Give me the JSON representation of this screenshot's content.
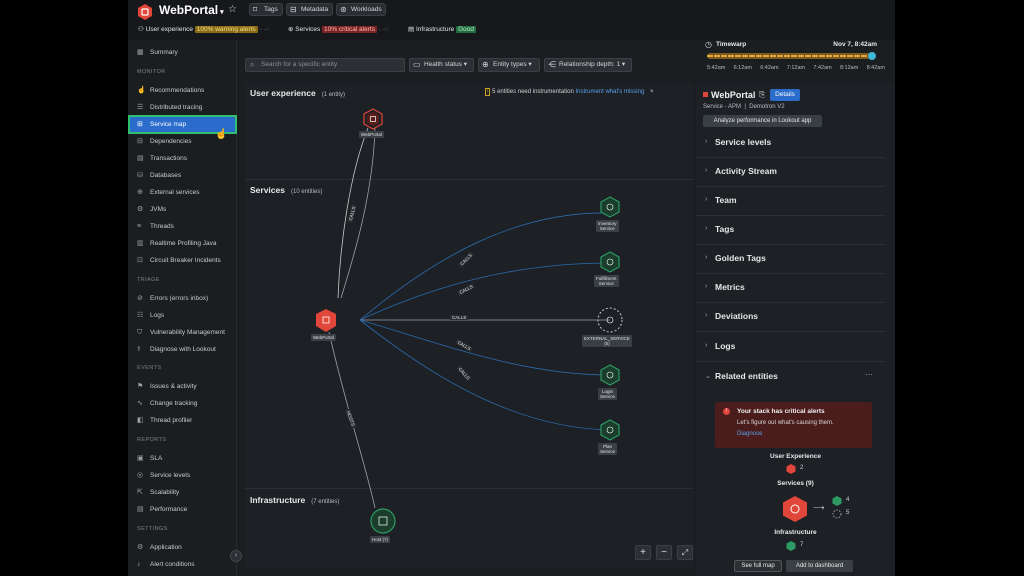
{
  "header": {
    "title": "WebPortal",
    "pills": [
      "Tags",
      "Metadata",
      "Workloads"
    ],
    "status": {
      "user_label": "User experience",
      "user_badge": "100% warning alerts",
      "services_label": "Services",
      "services_badge": "10% critical alerts",
      "infra_label": "Infrastructure",
      "infra_badge": "Good"
    },
    "timewarp": {
      "label": "Timewarp",
      "date": "Nov 7, 8:42am",
      "ticks": [
        "5:42am",
        "6:12am",
        "6:42am",
        "7:12am",
        "7:42am",
        "8:12am",
        "8:42am"
      ]
    }
  },
  "sidebar": {
    "summary": "Summary",
    "sections": {
      "monitor": "MONITOR",
      "triage": "TRIAGE",
      "events": "EVENTS",
      "reports": "REPORTS",
      "settings": "SETTINGS"
    },
    "items": {
      "recommendations": "Recommendations",
      "distributed_tracing": "Distributed tracing",
      "service_map": "Service map",
      "dependencies": "Dependencies",
      "transactions": "Transactions",
      "databases": "Databases",
      "external_services": "External services",
      "jvms": "JVMs",
      "threads": "Threads",
      "realtime_profiling": "Realtime Profiling Java",
      "circuit_breaker": "Circuit Breaker Incidents",
      "errors": "Errors (errors inbox)",
      "logs": "Logs",
      "vulnerability": "Vulnerability Management",
      "diagnose": "Diagnose with Lookout",
      "issues": "Issues & activity",
      "change_tracking": "Change tracking",
      "thread_profiler": "Thread profiler",
      "sla": "SLA",
      "service_levels": "Service levels",
      "scalability": "Scalability",
      "performance": "Performance",
      "application": "Application",
      "alert_conditions": "Alert conditions"
    }
  },
  "toolbar": {
    "search_placeholder": "Search for a specific entity",
    "health_status": "Health status",
    "entity_types": "Entity types",
    "relationship_depth": "Relationship depth: 1"
  },
  "map": {
    "user_experience": {
      "title": "User experience",
      "count": "(1 entity)"
    },
    "services": {
      "title": "Services",
      "count": "(10 entities)"
    },
    "infrastructure": {
      "title": "Infrastructure",
      "count": "(7 entities)"
    },
    "banner": {
      "text": "5 entities need instrumentation",
      "link": "Instrument what's missing"
    },
    "nodes": {
      "webportal_top": "WebPortal",
      "webportal_mid": "WebPortal",
      "inventory": "Inventory\nService",
      "fulfillment": "Fulfillment\nService",
      "external": "EXTERNAL_SERVICE\n(5)",
      "login": "Login\nService",
      "plan": "Plan\nService",
      "host": "Host (7)"
    },
    "edges": {
      "calls": "CALLS",
      "hosts": "HOSTS"
    }
  },
  "panel": {
    "title": "WebPortal",
    "details": "Details",
    "subtitle": "Service - APM  |  Demotron V2",
    "analyze": "Analyze performance in Lookout app",
    "sections": [
      "Service levels",
      "Activity Stream",
      "Team",
      "Tags",
      "Golden Tags",
      "Metrics",
      "Deviations",
      "Logs"
    ],
    "related": {
      "title": "Related entities",
      "alert_title": "Your stack has critical alerts",
      "alert_text": "Let's figure out what's causing them.",
      "alert_link": "Diagnose",
      "user_exp": "User Experience",
      "user_exp_count": "2",
      "services": "Services (9)",
      "svc_healthy": "4",
      "svc_unknown": "5",
      "infrastructure": "Infrastructure",
      "infra_count": "7",
      "see_full_map": "See full map",
      "add_dashboard": "Add to dashboard"
    }
  },
  "colors": {
    "accent": "#2a6ccb",
    "critical": "#e0463a",
    "healthy": "#2e9a63",
    "warning": "#c9a227"
  }
}
